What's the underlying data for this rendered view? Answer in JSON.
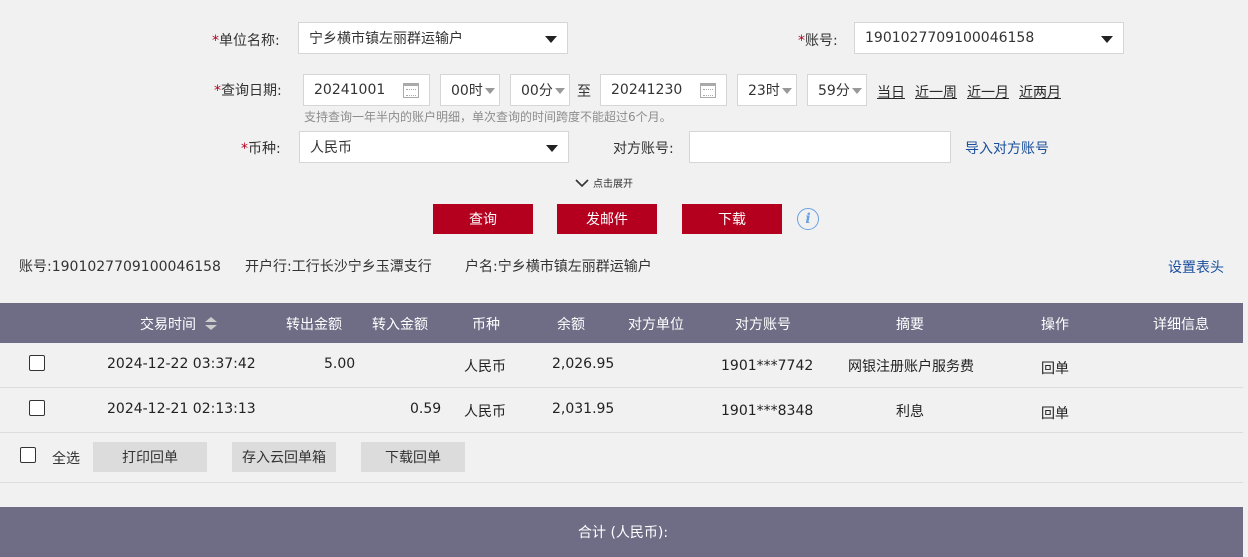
{
  "form": {
    "unit_label": "单位名称:",
    "unit_value": "宁乡横市镇左丽群运输户",
    "account_label": "账号:",
    "account_value": "1901027709100046158",
    "date_label": "查询日期:",
    "start_date": "20241001",
    "start_hour": "00时",
    "start_min": "00分",
    "to_label": "至",
    "end_date": "20241230",
    "end_hour": "23时",
    "end_min": "59分",
    "quick_links": [
      "当日",
      "近一周",
      "近一月",
      "近两月"
    ],
    "date_hint": "支持查询一年半内的账户明细，单次查询的时间跨度不能超过6个月。",
    "currency_label": "币种:",
    "currency_value": "人民币",
    "counterparty_label": "对方账号:",
    "counterparty_value": "",
    "import_link": "导入对方账号",
    "expand_label": "点击展开",
    "required_mark": "*"
  },
  "actions": {
    "query": "查询",
    "email": "发邮件",
    "download": "下载",
    "info_icon": "info-icon"
  },
  "account_info": {
    "account_label": "账号:",
    "account": "1901027709100046158",
    "bank_label": "开户行:",
    "bank": "工行长沙宁乡玉潭支行",
    "name_label": "户名:",
    "name": "宁乡横市镇左丽群运输户",
    "header_settings": "设置表头"
  },
  "table": {
    "headers": [
      "交易时间",
      "转出金额",
      "转入金额",
      "币种",
      "余额",
      "对方单位",
      "对方账号",
      "摘要",
      "操作",
      "详细信息"
    ],
    "rows": [
      {
        "time": "2024-12-22  03:37:42",
        "out": "5.00",
        "in": "",
        "currency": "人民币",
        "balance": "2,026.95",
        "party": "",
        "party_account": "1901***7742",
        "summary": "网银注册账户服务费",
        "op": "回单",
        "detail": ""
      },
      {
        "time": "2024-12-21  02:13:13",
        "out": "",
        "in": "0.59",
        "currency": "人民币",
        "balance": "2,031.95",
        "party": "",
        "party_account": "1901***8348",
        "summary": "利息",
        "op": "回单",
        "detail": ""
      }
    ]
  },
  "bulk": {
    "select_all": "全选",
    "print": "打印回单",
    "save_cloud": "存入云回单箱",
    "download": "下载回单"
  },
  "total": {
    "label": "合计 (人民币):"
  },
  "colors": {
    "accent": "#b4001e",
    "header_bg": "#6f6d86",
    "link": "#1a4e9c"
  }
}
